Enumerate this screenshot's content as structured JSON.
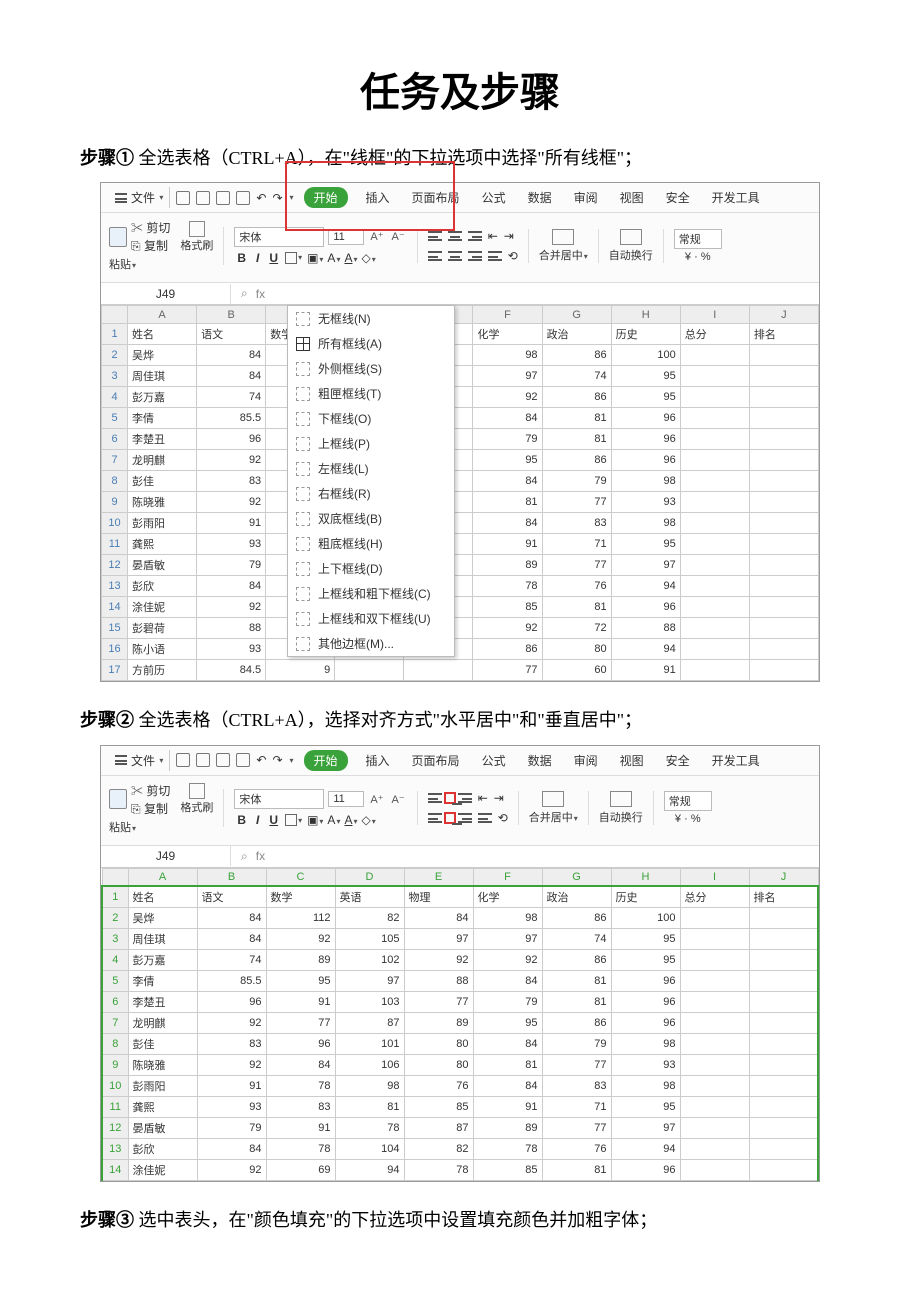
{
  "doc": {
    "title": "任务及步骤",
    "step1_label": "步骤①",
    "step1_text": " 全选表格（CTRL+A），在\"线框\"的下拉选项中选择\"所有线框\"；",
    "step2_label": "步骤②",
    "step2_text": " 全选表格（CTRL+A），选择对齐方式\"水平居中\"和\"垂直居中\"；",
    "step3_label": "步骤③",
    "step3_text": " 选中表头，在\"颜色填充\"的下拉选项中设置填充颜色并加粗字体；"
  },
  "ui": {
    "file_label": "文件",
    "quick": [
      "new",
      "open",
      "save",
      "preview",
      "undo",
      "redo",
      "more"
    ],
    "tabs": {
      "start": "开始",
      "insert": "插入",
      "layout": "页面布局",
      "formula": "公式",
      "data": "数据",
      "review": "审阅",
      "view": "视图",
      "security": "安全",
      "dev": "开发工具"
    },
    "clip": {
      "paste": "粘贴",
      "cut": "剪切",
      "copy": "复制",
      "fmt": "格式刷"
    },
    "font": {
      "name": "宋体",
      "size": "11",
      "B": "B",
      "I": "I",
      "U": "U"
    },
    "merge": "合并居中",
    "wrap": "自动换行",
    "numfmt": "常规",
    "namebox": "J49",
    "fx": "fx",
    "border_menu": {
      "none": "无框线(N)",
      "all": "所有框线(A)",
      "outside": "外侧框线(S)",
      "thickbox": "粗匣框线(T)",
      "bottom": "下框线(O)",
      "top": "上框线(P)",
      "left": "左框线(L)",
      "right": "右框线(R)",
      "dblbottom": "双底框线(B)",
      "thickbottom": "粗底框线(H)",
      "topbottom": "上下框线(D)",
      "topthickbottom": "上框线和粗下框线(C)",
      "topdblbottom": "上框线和双下框线(U)",
      "other": "其他边框(M)..."
    }
  },
  "grid1": {
    "cols": [
      "A",
      "B",
      "C",
      "D",
      "E",
      "F",
      "G",
      "H",
      "I",
      "J"
    ],
    "headers": [
      "姓名",
      "语文",
      "数学",
      "英语",
      "物理",
      "化学",
      "政治",
      "历史",
      "总分",
      "排名"
    ],
    "rows": [
      [
        "吴烨",
        "84",
        "11",
        "",
        "",
        "98",
        "86",
        "100",
        "",
        ""
      ],
      [
        "周佳琪",
        "84",
        "9",
        "",
        "",
        "97",
        "74",
        "95",
        "",
        ""
      ],
      [
        "彭万嘉",
        "74",
        "8",
        "",
        "",
        "92",
        "86",
        "95",
        "",
        ""
      ],
      [
        "李倩",
        "85.5",
        "9",
        "",
        "",
        "84",
        "81",
        "96",
        "",
        ""
      ],
      [
        "李楚丑",
        "96",
        "9",
        "",
        "",
        "79",
        "81",
        "96",
        "",
        ""
      ],
      [
        "龙明麒",
        "92",
        "7",
        "",
        "",
        "95",
        "86",
        "96",
        "",
        ""
      ],
      [
        "彭佳",
        "83",
        "9",
        "",
        "",
        "84",
        "79",
        "98",
        "",
        ""
      ],
      [
        "陈晓雅",
        "92",
        "8",
        "",
        "",
        "81",
        "77",
        "93",
        "",
        ""
      ],
      [
        "彭雨阳",
        "91",
        "7",
        "",
        "",
        "84",
        "83",
        "98",
        "",
        ""
      ],
      [
        "龚熙",
        "93",
        "8",
        "",
        "",
        "91",
        "71",
        "95",
        "",
        ""
      ],
      [
        "晏盾敏",
        "79",
        "9",
        "",
        "",
        "89",
        "77",
        "97",
        "",
        ""
      ],
      [
        "彭欣",
        "84",
        "7",
        "",
        "",
        "78",
        "76",
        "94",
        "",
        ""
      ],
      [
        "涂佳妮",
        "92",
        "6",
        "",
        "",
        "85",
        "81",
        "96",
        "",
        ""
      ],
      [
        "彭碧荷",
        "88",
        "7",
        "",
        "",
        "92",
        "72",
        "88",
        "",
        ""
      ],
      [
        "陈小语",
        "93",
        "7",
        "",
        "",
        "86",
        "80",
        "94",
        "",
        ""
      ],
      [
        "方前历",
        "84.5",
        "9",
        "",
        "",
        "77",
        "60",
        "91",
        "",
        ""
      ]
    ]
  },
  "grid2": {
    "cols": [
      "A",
      "B",
      "C",
      "D",
      "E",
      "F",
      "G",
      "H",
      "I",
      "J"
    ],
    "headers": [
      "姓名",
      "语文",
      "数学",
      "英语",
      "物理",
      "化学",
      "政治",
      "历史",
      "总分",
      "排名"
    ],
    "rows": [
      [
        "吴烨",
        "84",
        "112",
        "82",
        "84",
        "98",
        "86",
        "100",
        "",
        ""
      ],
      [
        "周佳琪",
        "84",
        "92",
        "105",
        "97",
        "97",
        "74",
        "95",
        "",
        ""
      ],
      [
        "彭万嘉",
        "74",
        "89",
        "102",
        "92",
        "92",
        "86",
        "95",
        "",
        ""
      ],
      [
        "李倩",
        "85.5",
        "95",
        "97",
        "88",
        "84",
        "81",
        "96",
        "",
        ""
      ],
      [
        "李楚丑",
        "96",
        "91",
        "103",
        "77",
        "79",
        "81",
        "96",
        "",
        ""
      ],
      [
        "龙明麒",
        "92",
        "77",
        "87",
        "89",
        "95",
        "86",
        "96",
        "",
        ""
      ],
      [
        "彭佳",
        "83",
        "96",
        "101",
        "80",
        "84",
        "79",
        "98",
        "",
        ""
      ],
      [
        "陈晓雅",
        "92",
        "84",
        "106",
        "80",
        "81",
        "77",
        "93",
        "",
        ""
      ],
      [
        "彭雨阳",
        "91",
        "78",
        "98",
        "76",
        "84",
        "83",
        "98",
        "",
        ""
      ],
      [
        "龚熙",
        "93",
        "83",
        "81",
        "85",
        "91",
        "71",
        "95",
        "",
        ""
      ],
      [
        "晏盾敏",
        "79",
        "91",
        "78",
        "87",
        "89",
        "77",
        "97",
        "",
        ""
      ],
      [
        "彭欣",
        "84",
        "78",
        "104",
        "82",
        "78",
        "76",
        "94",
        "",
        ""
      ],
      [
        "涂佳妮",
        "92",
        "69",
        "94",
        "78",
        "85",
        "81",
        "96",
        "",
        ""
      ]
    ]
  },
  "chart_data": {
    "type": "table",
    "title": "学生成绩表",
    "columns": [
      "姓名",
      "语文",
      "数学",
      "英语",
      "物理",
      "化学",
      "政治",
      "历史",
      "总分",
      "排名"
    ],
    "rows": [
      [
        "吴烨",
        84,
        112,
        82,
        84,
        98,
        86,
        100,
        null,
        null
      ],
      [
        "周佳琪",
        84,
        92,
        105,
        97,
        97,
        74,
        95,
        null,
        null
      ],
      [
        "彭万嘉",
        74,
        89,
        102,
        92,
        92,
        86,
        95,
        null,
        null
      ],
      [
        "李倩",
        85.5,
        95,
        97,
        88,
        84,
        81,
        96,
        null,
        null
      ],
      [
        "李楚丑",
        96,
        91,
        103,
        77,
        79,
        81,
        96,
        null,
        null
      ],
      [
        "龙明麒",
        92,
        77,
        87,
        89,
        95,
        86,
        96,
        null,
        null
      ],
      [
        "彭佳",
        83,
        96,
        101,
        80,
        84,
        79,
        98,
        null,
        null
      ],
      [
        "陈晓雅",
        92,
        84,
        106,
        80,
        81,
        77,
        93,
        null,
        null
      ],
      [
        "彭雨阳",
        91,
        78,
        98,
        76,
        84,
        83,
        98,
        null,
        null
      ],
      [
        "龚熙",
        93,
        83,
        81,
        85,
        91,
        71,
        95,
        null,
        null
      ],
      [
        "晏盾敏",
        79,
        91,
        78,
        87,
        89,
        77,
        97,
        null,
        null
      ],
      [
        "彭欣",
        84,
        78,
        104,
        82,
        78,
        76,
        94,
        null,
        null
      ],
      [
        "涂佳妮",
        92,
        69,
        94,
        78,
        85,
        81,
        96,
        null,
        null
      ],
      [
        "彭碧荷",
        88,
        null,
        null,
        null,
        92,
        72,
        88,
        null,
        null
      ],
      [
        "陈小语",
        93,
        null,
        null,
        null,
        86,
        80,
        94,
        null,
        null
      ],
      [
        "方前历",
        84.5,
        null,
        null,
        null,
        77,
        60,
        91,
        null,
        null
      ]
    ]
  }
}
